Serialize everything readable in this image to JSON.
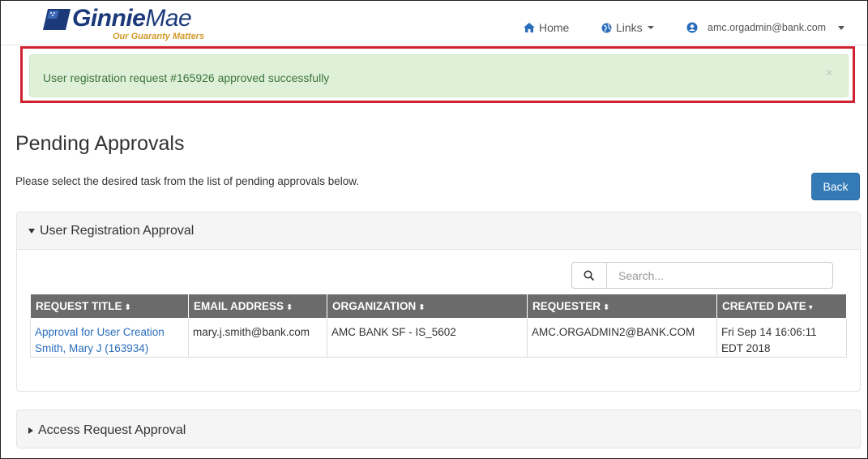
{
  "brand": {
    "name_bold": "Ginnie",
    "name_light": "Mae",
    "tagline": "Our Guaranty Matters",
    "primary_color": "#1c3a7a",
    "accent_color": "#d29a2a"
  },
  "nav": {
    "home": "Home",
    "links": "Links",
    "user": "amc.orgadmin@bank.com"
  },
  "alert": {
    "message": "User registration request #165926 approved successfully",
    "close": "×",
    "color": "#3c763d"
  },
  "page": {
    "title": "Pending Approvals",
    "description": "Please select the desired task from the list of pending approvals below.",
    "back_label": "Back"
  },
  "user_registration_panel": {
    "title": "User Registration Approval",
    "search_placeholder": "Search...",
    "columns": [
      "REQUEST TITLE",
      "EMAIL ADDRESS",
      "ORGANIZATION",
      "REQUESTER",
      "CREATED DATE"
    ],
    "rows": [
      {
        "request_title_line1": "Approval for User Creation",
        "request_title_line2": "Smith, Mary J (163934)",
        "email": "mary.j.smith@bank.com",
        "organization": "AMC BANK SF - IS_5602",
        "requester": "AMC.ORGADMIN2@BANK.COM",
        "created_line1": "Fri Sep 14 16:06:11",
        "created_line2": "EDT 2018"
      }
    ]
  },
  "access_request_panel": {
    "title": "Access Request Approval"
  },
  "icons": {
    "home": "home-icon",
    "links": "globe-icon",
    "user": "user-circle-icon",
    "search": "search-icon"
  }
}
